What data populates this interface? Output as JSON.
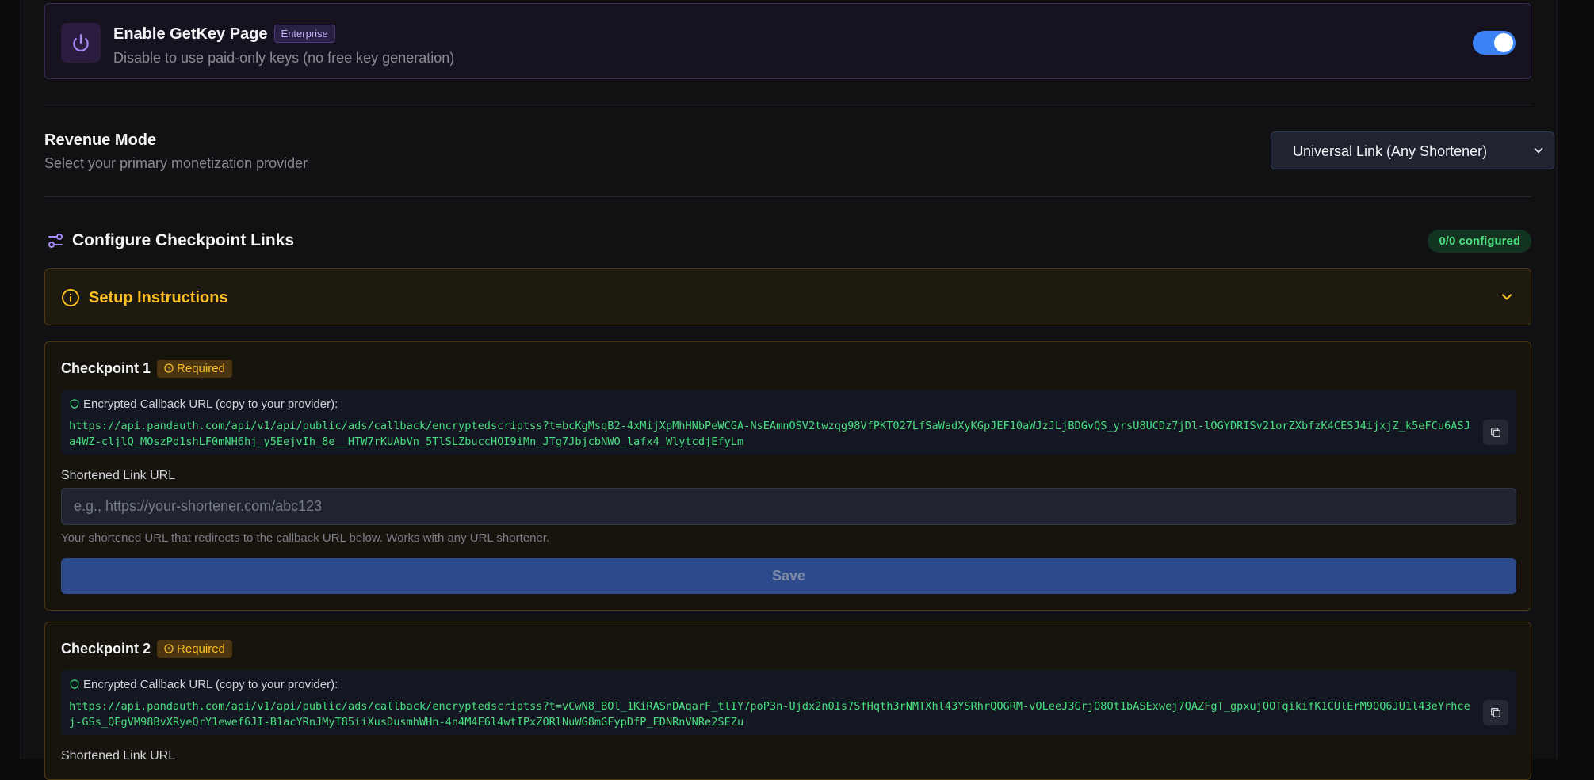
{
  "enable": {
    "title": "Enable GetKey Page",
    "badge": "Enterprise",
    "subtitle": "Disable to use paid-only keys (no free key generation)",
    "toggle_on": true
  },
  "revenue": {
    "title": "Revenue Mode",
    "subtitle": "Select your primary monetization provider",
    "selected": "Universal Link (Any Shortener)"
  },
  "configure": {
    "title": "Configure Checkpoint Links",
    "badge": "0/0 configured"
  },
  "setup": {
    "title": "Setup Instructions"
  },
  "checkpoints": [
    {
      "title": "Checkpoint 1",
      "required": "Required",
      "callback_label": "Encrypted Callback URL (copy to your provider):",
      "callback_url": "https://api.pandauth.com/api/v1/api/public/ads/callback/encryptedscriptss?t=bcKgMsqB2-4xMijXpMhHNbPeWCGA-NsEAmnOSV2twzqg98VfPKT027LfSaWadXyKGpJEF10aWJzJLjBDGvQS_yrsU8UCDz7jDl-lOGYDRISv21orZXbfzK4CESJ4ijxjZ_k5eFCu6ASJa4WZ-cljlQ_MOszPd1shLF0mNH6hj_y5EejvIh_8e__HTW7rKUAbVn_5TlSLZbuccHOI9iMn_JTg7JbjcbNWO_lafx4_WlytcdjEfyLm",
      "short_label": "Shortened Link URL",
      "short_placeholder": "e.g., https://your-shortener.com/abc123",
      "help": "Your shortened URL that redirects to the callback URL below. Works with any URL shortener.",
      "save_label": "Save"
    },
    {
      "title": "Checkpoint 2",
      "required": "Required",
      "callback_label": "Encrypted Callback URL (copy to your provider):",
      "callback_url": "https://api.pandauth.com/api/v1/api/public/ads/callback/encryptedscriptss?t=vCwN8_BOl_1KiRASnDAqarF_tlIY7poP3n-Ujdx2n0Is7SfHqth3rNMTXhl43YSRhrQOGRM-vOLeeJ3GrjO8Ot1bASExwej7QAZFgT_gpxujOOTqikifK1CUlErM9OQ6JU1l43eYrhcej-GSs_QEgVM98BvXRyeQrY1ewef6JI-B1acYRnJMyT85iiXusDusmhWHn-4n4M4E6l4wtIPxZORlNuWG8mGFypDfP_EDNRnVNRe2SEZu",
      "short_label": "Shortened Link URL"
    }
  ]
}
